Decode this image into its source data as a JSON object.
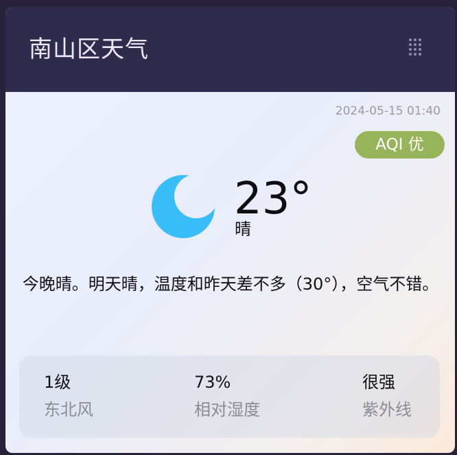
{
  "header": {
    "title": "南山区天气",
    "menu_icon": "grid-dots-icon"
  },
  "weather": {
    "timestamp": "2024-05-15 01:40",
    "aqi": "AQI 优",
    "temperature": "23°",
    "condition": "晴",
    "condition_icon": "moon-icon",
    "summary": "今晚晴。明天晴，温度和昨天差不多（30°），空气不错。"
  },
  "stats": [
    {
      "value": "1级",
      "label": "东北风"
    },
    {
      "value": "73%",
      "label": "相对湿度"
    },
    {
      "value": "很强",
      "label": "紫外线"
    }
  ],
  "colors": {
    "header_bg": "#2f2b4d",
    "aqi_badge": "#97b45b",
    "moon": "#38bdf8"
  }
}
